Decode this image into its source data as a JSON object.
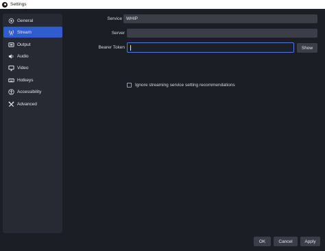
{
  "window": {
    "title": "Settings"
  },
  "sidebar": {
    "items": [
      {
        "label": "General",
        "icon": "gear-icon"
      },
      {
        "label": "Stream",
        "icon": "antenna-icon",
        "active": true
      },
      {
        "label": "Output",
        "icon": "output-icon"
      },
      {
        "label": "Audio",
        "icon": "speaker-icon"
      },
      {
        "label": "Video",
        "icon": "monitor-icon"
      },
      {
        "label": "Hotkeys",
        "icon": "keyboard-icon"
      },
      {
        "label": "Accessibility",
        "icon": "accessibility-icon"
      },
      {
        "label": "Advanced",
        "icon": "tools-icon"
      }
    ]
  },
  "stream": {
    "service_label": "Service",
    "service_value": "WHIP",
    "server_label": "Server",
    "server_value": "",
    "bearer_label": "Bearer Token",
    "bearer_value": "",
    "show_label": "Show",
    "ignore_label": "Ignore streaming service setting recommendations",
    "ignore_checked": false
  },
  "footer": {
    "ok_label": "OK",
    "cancel_label": "Cancel",
    "apply_label": "Apply"
  },
  "colors": {
    "background": "#1c1e26",
    "panel": "#272a33",
    "accent": "#2f5ccf",
    "field": "#3b3e47",
    "focus_border": "#4c7be0"
  }
}
